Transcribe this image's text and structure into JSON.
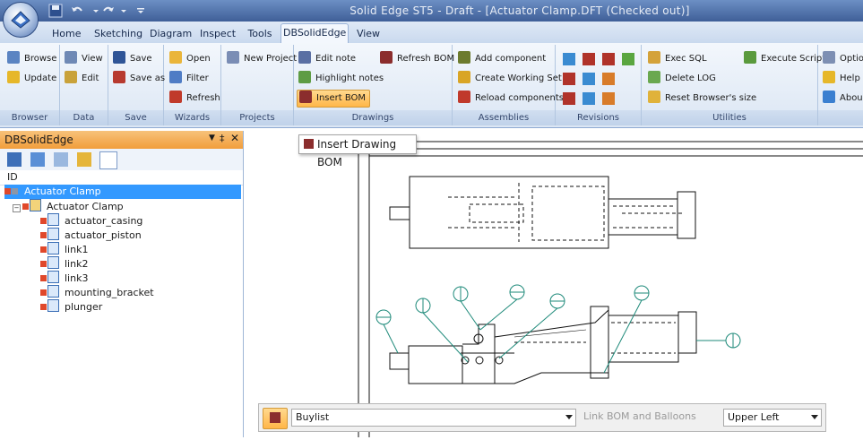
{
  "window": {
    "title": "Solid Edge ST5 - Draft - [Actuator Clamp.DFT (Checked out)]"
  },
  "tabs": [
    "Home",
    "Sketching",
    "Diagram",
    "Inspect",
    "Tools",
    "DBSolidEdge",
    "View"
  ],
  "active_tab": "DBSolidEdge",
  "ribbon": {
    "groups": {
      "browser": {
        "label": "Browser",
        "browse": "Browse",
        "update": "Update"
      },
      "data": {
        "label": "Data",
        "view": "View",
        "edit": "Edit"
      },
      "save": {
        "label": "Save",
        "save": "Save",
        "save_as": "Save as"
      },
      "wizards": {
        "label": "Wizards",
        "open": "Open",
        "filter": "Filter",
        "refresh": "Refresh"
      },
      "projects": {
        "label": "Projects",
        "new_project": "New Project"
      },
      "drawings": {
        "label": "Drawings",
        "edit_note": "Edit note",
        "refresh_bom": "Refresh BOM",
        "highlight_notes": "Highlight notes",
        "insert_bom": "Insert BOM"
      },
      "assemblies": {
        "label": "Assemblies",
        "add_component": "Add component",
        "create_working_set": "Create Working Set",
        "reload_components": "Reload components"
      },
      "revisions": {
        "label": "Revisions"
      },
      "utilities": {
        "label": "Utilities",
        "exec_sql": "Exec SQL",
        "execute_script": "Execute Script",
        "delete_log": "Delete LOG",
        "reset_browser": "Reset Browser's size"
      },
      "extra": {
        "options": "Optio",
        "help": "Help",
        "about": "Abou"
      }
    }
  },
  "left_panel": {
    "title": "DBSolidEdge",
    "column_header": "ID",
    "root": "Actuator Clamp",
    "assembly": "Actuator Clamp",
    "parts": [
      "actuator_casing",
      "actuator_piston",
      "link1",
      "link2",
      "link3",
      "mounting_bracket",
      "plunger"
    ]
  },
  "tooltip": {
    "text": "Insert Drawing BOM"
  },
  "bottom_bar": {
    "bom_type": "Buylist",
    "link_placeholder": "Link BOM and Balloons",
    "position": "Upper Left"
  },
  "colors": {
    "accent": "#f19d3b",
    "selection": "#3399ff",
    "title_bar": "#4a6aa5"
  }
}
